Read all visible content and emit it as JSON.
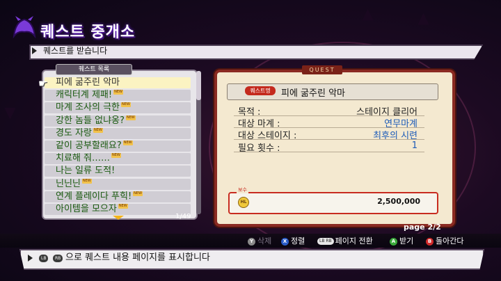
{
  "header": {
    "title": "퀘스트 중개소",
    "subtitle": "퀘스트를 받습니다"
  },
  "quest_list": {
    "header": "퀘스트 목록",
    "new_badge": "NEW",
    "items": [
      {
        "label": "피에 굶주린 악마",
        "new": false
      },
      {
        "label": "캐릭터계 제패!",
        "new": true
      },
      {
        "label": "마계 조사의 극한",
        "new": true
      },
      {
        "label": "강한 놈들 없냐옹?",
        "new": true
      },
      {
        "label": "경도 자랑",
        "new": true
      },
      {
        "label": "같이 공부할래요?",
        "new": true
      },
      {
        "label": "치료해 줘……",
        "new": true
      },
      {
        "label": "나는 일류 도적!",
        "new": false
      },
      {
        "label": "닌닌닌",
        "new": true
      },
      {
        "label": "연계 플레이다 푸힉!",
        "new": true
      },
      {
        "label": "아이템을 모으자",
        "new": true
      }
    ],
    "count": "1/49"
  },
  "quest_detail": {
    "tab": "QUEST",
    "badge": "퀘스트명",
    "title": "피에 굶주린 악마",
    "rows": [
      {
        "label": "목적 :",
        "value": "스테이지 클리어",
        "highlight": false
      },
      {
        "label": "대상 마계 :",
        "value": "연무마계",
        "highlight": true
      },
      {
        "label": "대상 스테이지 :",
        "value": "최후의 시련",
        "highlight": true
      },
      {
        "label": "필요 횟수 :",
        "value": "1",
        "highlight": true
      }
    ],
    "reward_label": "보수",
    "reward_icon": "HL",
    "reward_amount": "2,500,000",
    "page": "page 2/2"
  },
  "controls": [
    {
      "button": "Y",
      "color": "#8a8a8a",
      "label": "삭제",
      "enabled": false
    },
    {
      "button": "X",
      "color": "#2a5cc8",
      "label": "정렬",
      "enabled": true
    },
    {
      "button": "LB RB",
      "color": "#e8e8e8",
      "label": "페이지 전환",
      "enabled": true
    },
    {
      "button": "A",
      "color": "#3aa83a",
      "label": "받기",
      "enabled": true
    },
    {
      "button": "B",
      "color": "#d02a2a",
      "label": "돌아간다",
      "enabled": true
    }
  ],
  "help": {
    "lb": "LB",
    "rb": "RB",
    "text": "으로 퀘스트 내용 페이지를 표시합니다"
  },
  "colors": {
    "accent": "#8a2a22",
    "list_text": "#1a5a10",
    "value_blue": "#1d5bb8",
    "reward_red": "#c82c20"
  }
}
